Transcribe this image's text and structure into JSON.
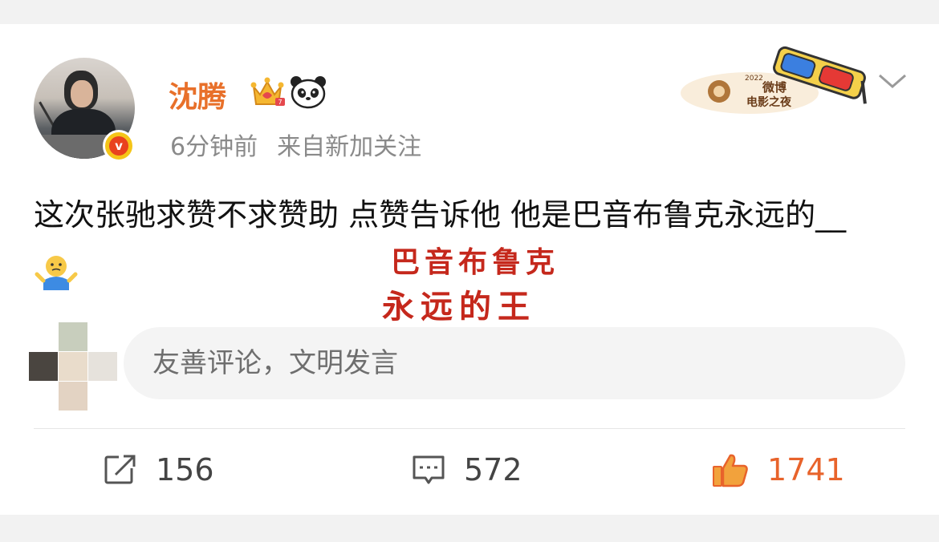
{
  "post": {
    "username": "沈腾",
    "time": "6分钟前",
    "source": "来自新加关注",
    "text": "这次张驰求赞不求赞助 点赞告诉他 他是巴音布鲁克永远的__",
    "overlay_line1": "巴音布鲁克",
    "overlay_line2": "永远的王",
    "badge_art_text": "2022 微博 电影之夜"
  },
  "comment": {
    "placeholder": "友善评论，文明发言"
  },
  "actions": {
    "repost_count": "156",
    "comment_count": "572",
    "like_count": "1741"
  },
  "icons": {
    "crown": "crown-icon",
    "panda": "panda-icon",
    "verified": "verified-v-icon",
    "chevron": "chevron-down-icon",
    "emoji": "shrug-emoji-icon",
    "repost": "repost-icon",
    "comment": "comment-icon",
    "like": "thumbs-up-icon"
  },
  "colors": {
    "username": "#e8702a",
    "like_active": "#e8632b",
    "overlay_text": "#c5281c",
    "meta_text": "#8a8a8a"
  }
}
